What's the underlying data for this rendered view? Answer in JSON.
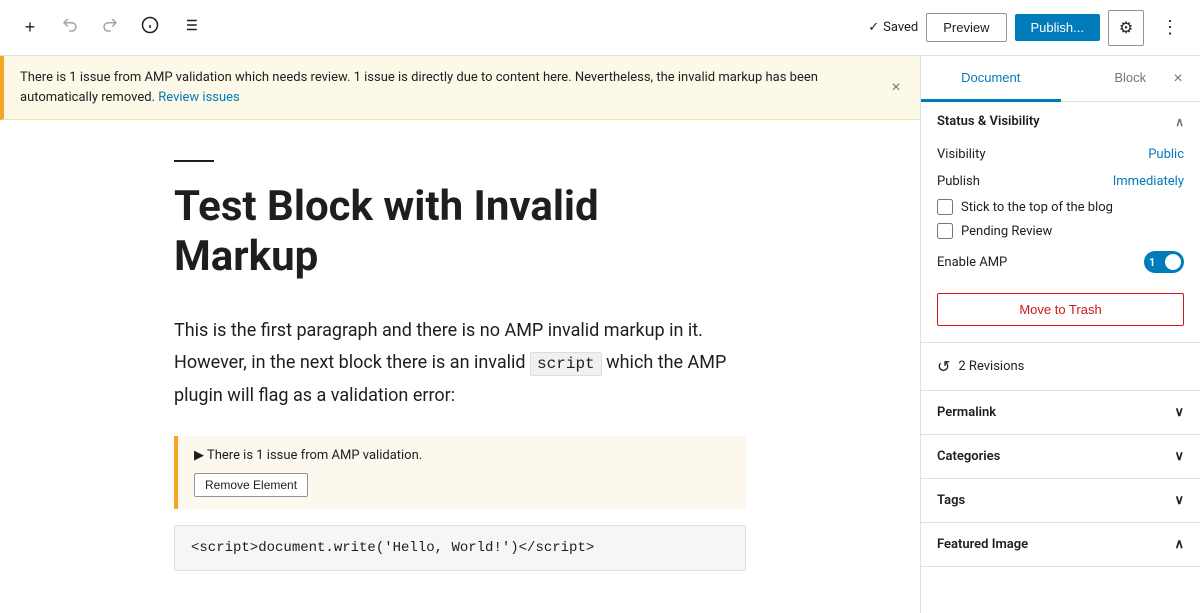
{
  "toolbar": {
    "add_icon": "+",
    "undo_icon": "↺",
    "redo_icon": "↻",
    "info_icon": "ℹ",
    "list_icon": "≡",
    "saved_label": "Saved",
    "preview_label": "Preview",
    "publish_label": "Publish...",
    "gear_icon": "⚙",
    "more_icon": "⋮"
  },
  "amp_banner": {
    "message": "There is 1 issue from AMP validation which needs review. 1 issue is directly due to content here. Nevertheless, the invalid markup has been automatically removed.",
    "link_text": "Review issues",
    "close_icon": "×"
  },
  "post": {
    "title": "Test Block with Invalid Markup",
    "body_part1": "This is the first paragraph and there is no AMP invalid markup in it. However, in the next block there is an invalid ",
    "body_code": "script",
    "body_part2": " which the AMP plugin will flag as a validation error:",
    "amp_warning_text": "▶ There is 1 issue from AMP validation.",
    "remove_element_label": "Remove Element",
    "code_content": "<script>document.write('Hello, World!')</script>"
  },
  "sidebar": {
    "tabs": [
      {
        "id": "document",
        "label": "Document",
        "active": true
      },
      {
        "id": "block",
        "label": "Block",
        "active": false
      }
    ],
    "close_icon": "×",
    "status_visibility": {
      "heading": "Status & Visibility",
      "visibility_label": "Visibility",
      "visibility_value": "Public",
      "publish_label": "Publish",
      "publish_value": "Immediately",
      "stick_label": "Stick to the top of the blog",
      "pending_label": "Pending Review",
      "enable_amp_label": "Enable AMP",
      "toggle_on_label": "1",
      "move_trash_label": "Move to Trash"
    },
    "revisions": {
      "label": "2 Revisions",
      "icon": "↺"
    },
    "permalink": {
      "label": "Permalink",
      "chevron": "∨"
    },
    "categories": {
      "label": "Categories",
      "chevron": "∨"
    },
    "tags": {
      "label": "Tags",
      "chevron": "∨"
    },
    "featured_image": {
      "label": "Featured Image",
      "chevron": "∧"
    }
  }
}
